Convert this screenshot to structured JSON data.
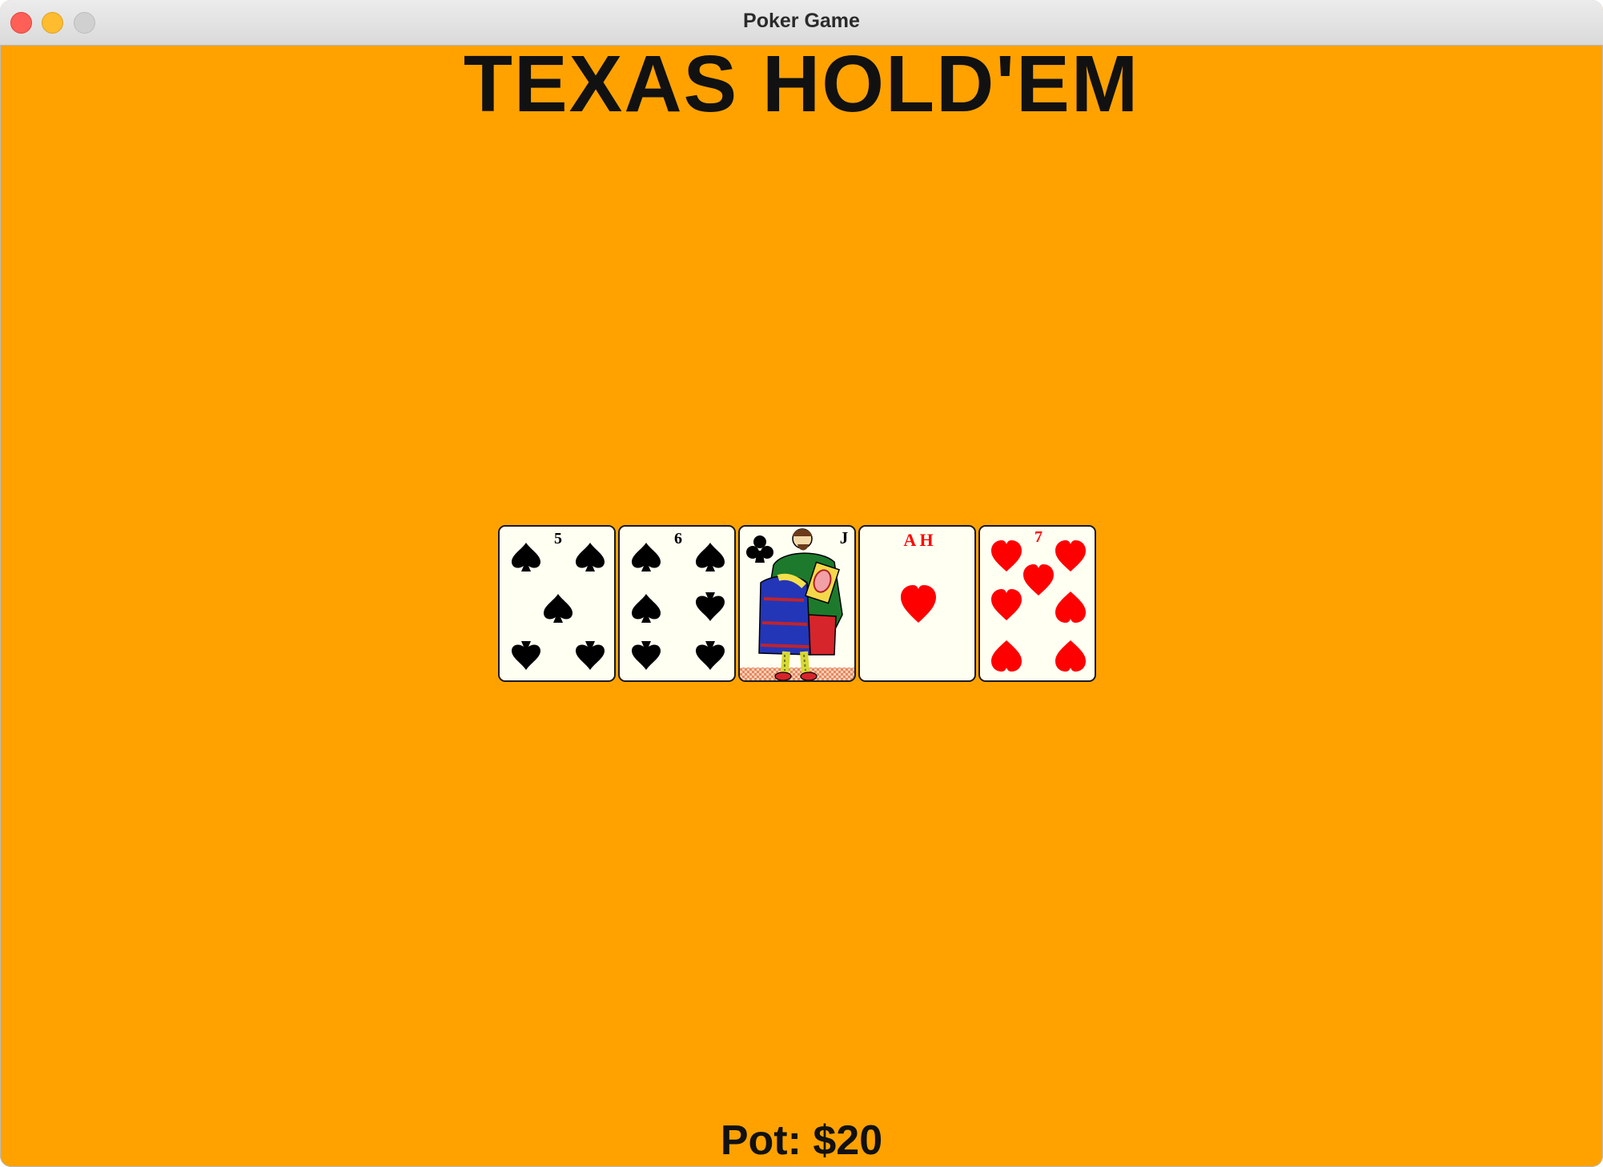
{
  "window": {
    "title": "Poker Game"
  },
  "game": {
    "title": "TEXAS HOLD'EM",
    "pot_label": "Pot: $20"
  },
  "board": {
    "cards": [
      {
        "rank": "5",
        "suit": "spades",
        "color": "#000000"
      },
      {
        "rank": "6",
        "suit": "spades",
        "color": "#000000"
      },
      {
        "rank": "J",
        "suit": "clubs",
        "color": "#000000"
      },
      {
        "rank": "A H",
        "suit": "hearts",
        "color": "#ff0000"
      },
      {
        "rank": "7",
        "suit": "hearts",
        "color": "#ff0000"
      }
    ]
  },
  "colors": {
    "table": "#FFA200",
    "card_face": "#fffff2",
    "red_suit": "#ff0000",
    "black_suit": "#000000"
  }
}
